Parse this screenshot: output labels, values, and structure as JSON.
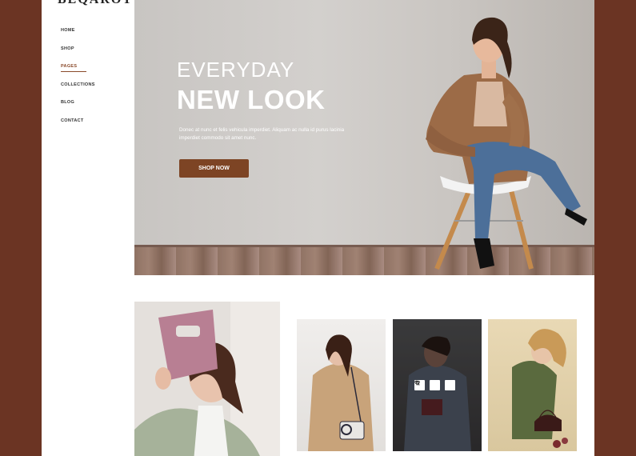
{
  "brand": {
    "logo_text": "BEQAROT"
  },
  "nav": {
    "items": [
      {
        "label": "HOME",
        "active": false
      },
      {
        "label": "SHOP",
        "active": false
      },
      {
        "label": "PAGES",
        "active": true
      },
      {
        "label": "COLLECTIONS",
        "active": false
      },
      {
        "label": "BLOG",
        "active": false
      },
      {
        "label": "CONTACT",
        "active": false
      }
    ]
  },
  "hero": {
    "eyebrow": "EVERYDAY",
    "title": "NEW LOOK",
    "description": "Donec at nunc et felis vehicula imperdiet. Aliquam ac nulla id purus lacinia imperdiet commodo sit amet nunc.",
    "button_label": "SHOP NOW"
  },
  "products": {
    "overlay_icons": [
      "cart-icon",
      "heart-icon",
      "zoom-icon"
    ]
  },
  "colors": {
    "background": "#6b3423",
    "accent": "#7d4424"
  }
}
